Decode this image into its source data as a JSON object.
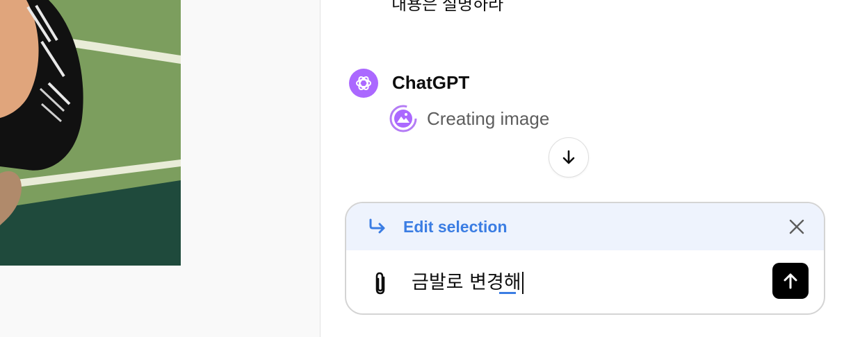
{
  "previous_message": {
    "text": "내용은 설명하라"
  },
  "assistant": {
    "name": "ChatGPT",
    "avatar_icon": "openai-logo-icon",
    "avatar_color": "#ab68ff",
    "status_label": "Creating image",
    "status_icon": "image-icon"
  },
  "scroll_button": {
    "icon": "arrow-down-icon"
  },
  "composer": {
    "edit_bar": {
      "label": "Edit selection",
      "icon": "curved-arrow-right-icon",
      "close_icon": "close-icon",
      "background": "#eef3fd",
      "accent": "#3b7de3"
    },
    "attach_icon": "paperclip-icon",
    "input_value": "금발로 변경해",
    "send_icon": "arrow-up-icon"
  }
}
